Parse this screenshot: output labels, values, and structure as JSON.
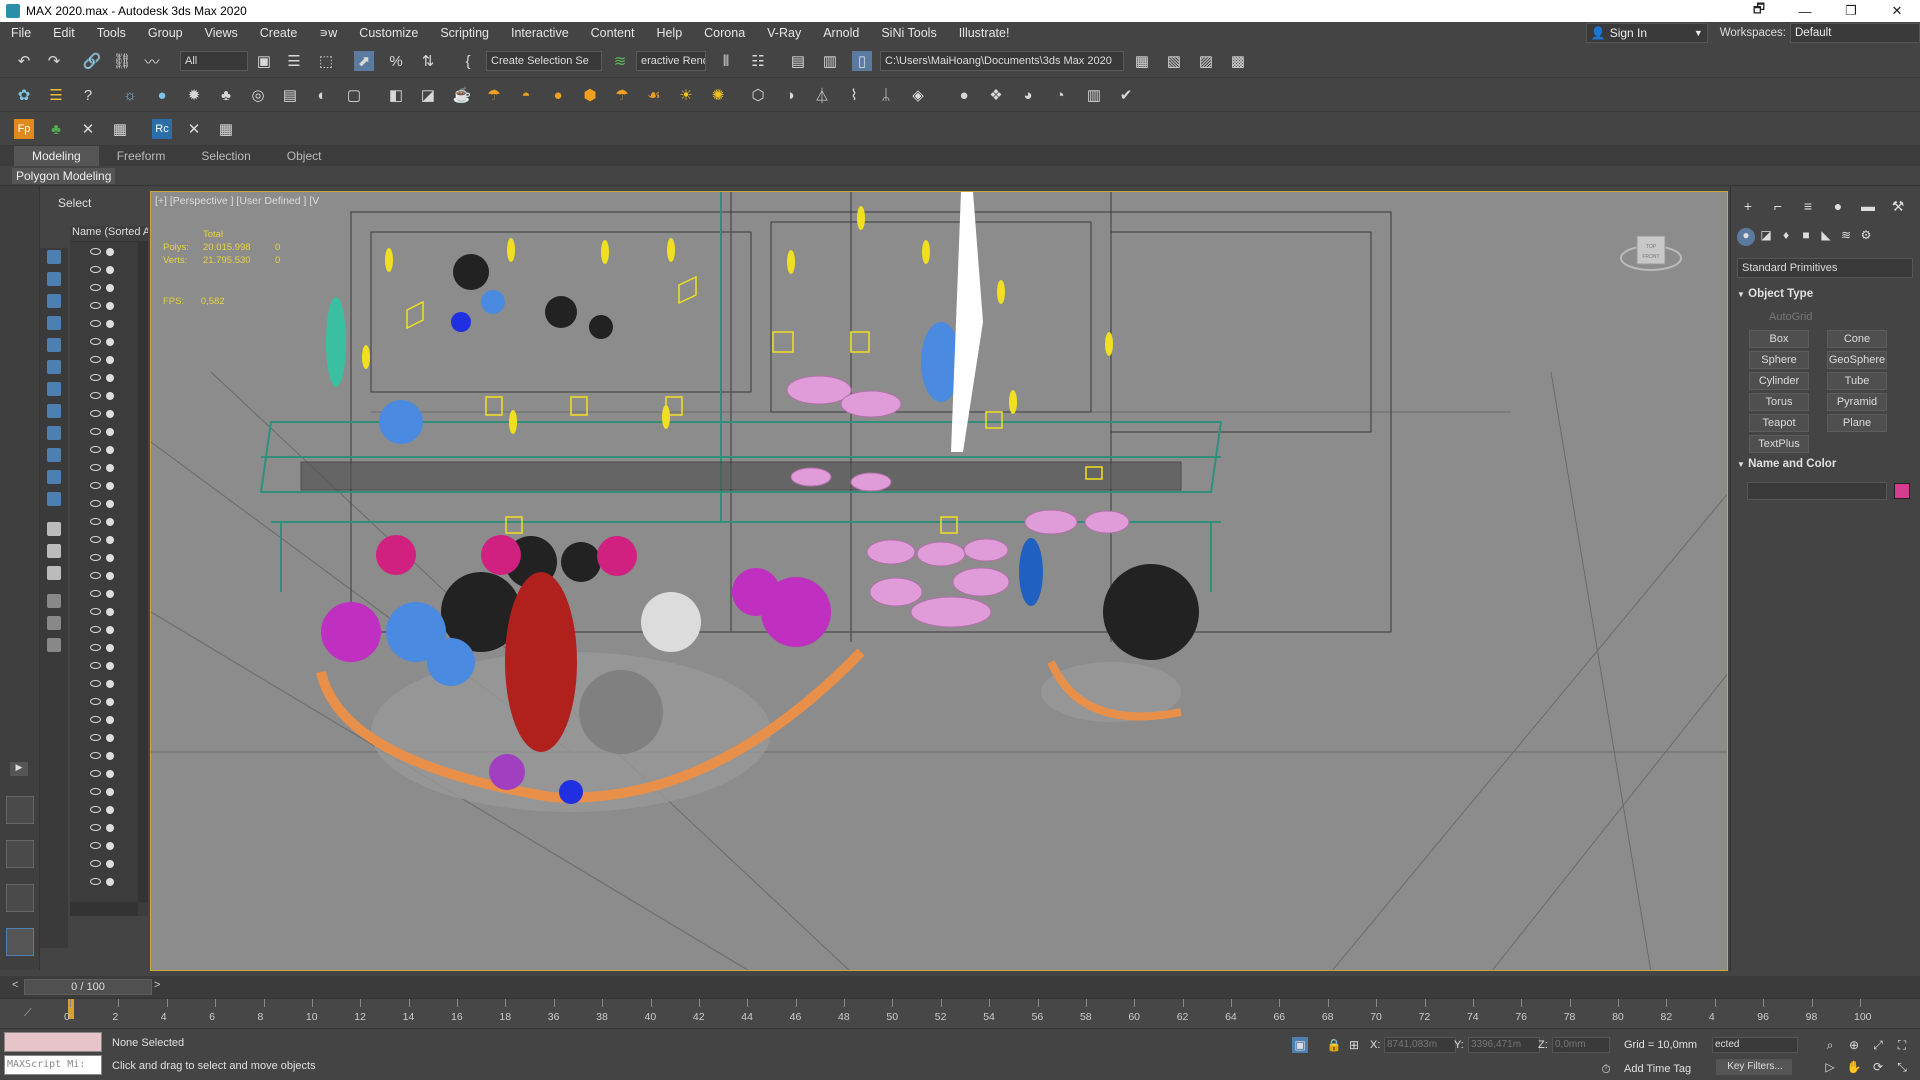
{
  "window": {
    "title": "MAX 2020.max - Autodesk 3ds Max 2020",
    "controls": [
      "🗗",
      "—",
      "❐",
      "✕"
    ]
  },
  "menu": [
    "File",
    "Edit",
    "Tools",
    "Group",
    "Views",
    "Create",
    "∍w",
    "Customize",
    "Scripting",
    "Interactive",
    "Content",
    "Help",
    "Corona",
    "V-Ray",
    "Arnold",
    "SiNi Tools",
    "Illustrate!"
  ],
  "account": {
    "sign_in": "Sign In",
    "workspaces_label": "Workspaces:",
    "workspace_value": "Default"
  },
  "main_toolbar": {
    "selection_filter": "All",
    "selection_set": "Create Selection Se",
    "renderer": "eractive Rend",
    "project_path": "C:\\Users\\MaiHoang\\Documents\\3ds Max 2020"
  },
  "ribbon": {
    "tabs": [
      "Modeling",
      "Freeform",
      "Selection",
      "Object"
    ],
    "active_tab": "Modeling",
    "sub_label": "Polygon Modeling"
  },
  "scene_explorer": {
    "title": "Select",
    "column_header": "Name (Sorted A"
  },
  "viewport": {
    "label": "[+] [Perspective ] [User Defined ] [V",
    "stats_header": "Total",
    "stats": [
      {
        "key": "Polys:",
        "value": "20.015.998",
        "sel": "0"
      },
      {
        "key": "Verts:",
        "value": "21.795.530",
        "sel": "0"
      }
    ],
    "fps_key": "FPS:",
    "fps_value": "0,582",
    "viewcube_top": "TOP",
    "viewcube_front": "FRONT"
  },
  "command_panel": {
    "category": "Standard Primitives",
    "object_type_title": "Object Type",
    "autogrid_label": "AutoGrid",
    "primitives": [
      "Box",
      "Cone",
      "Sphere",
      "GeoSphere",
      "Cylinder",
      "Tube",
      "Torus",
      "Pyramid",
      "Teapot",
      "Plane",
      "TextPlus"
    ],
    "name_color_title": "Name and Color",
    "object_color": "#d63c8e"
  },
  "time": {
    "frame_display": "0 / 100",
    "ticks": [
      "0",
      "2",
      "4",
      "6",
      "8",
      "10",
      "12",
      "14",
      "16",
      "18",
      "36",
      "38",
      "40",
      "42",
      "44",
      "46",
      "48",
      "50",
      "52",
      "54",
      "56",
      "58",
      "60",
      "62",
      "64",
      "66",
      "68",
      "70",
      "72",
      "74",
      "76",
      "78",
      "80",
      "82",
      "4",
      "96",
      "98",
      "100"
    ]
  },
  "status_bar": {
    "maxscript_hint": "MAXScript Mi:",
    "selection_status": "None Selected",
    "prompt": "Click and drag to select and move objects",
    "x_label": "X:",
    "x_value": "8741,083m",
    "y_label": "Y:",
    "y_value": "3396,471m",
    "z_label": "Z:",
    "z_value": "0,0mm",
    "grid": "Grid = 10,0mm",
    "add_time_tag": "Add Time Tag",
    "selected_dd": "ected",
    "key_filters": "Key Filters..."
  }
}
